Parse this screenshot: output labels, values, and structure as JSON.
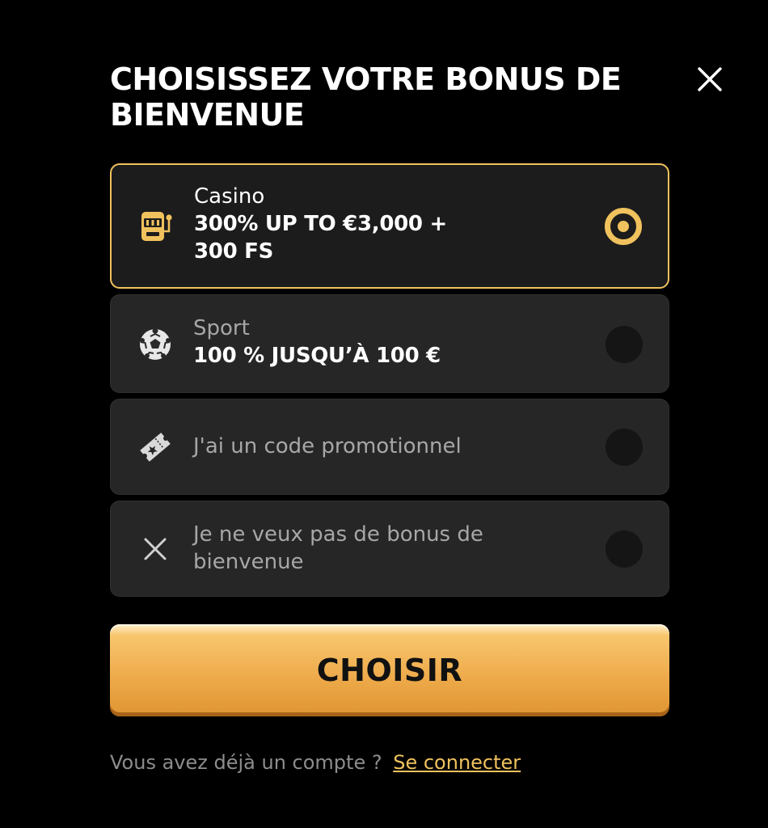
{
  "header": {
    "title": "CHOISISSEZ VOTRE BONUS DE BIENVENUE",
    "close_icon": "close-icon"
  },
  "options": [
    {
      "label": "Casino",
      "offer": "300% UP TO €3,000 + 300 FS",
      "icon": "slot-machine-icon",
      "selected": true
    },
    {
      "label": "Sport",
      "offer": "100 % JUSQU’À 100 €",
      "icon": "soccer-ball-icon",
      "selected": false
    },
    {
      "label": "J'ai un code promotionnel",
      "icon": "promo-ticket-icon",
      "selected": false
    },
    {
      "label": "Je ne veux pas de bonus de bienvenue",
      "icon": "no-bonus-x-icon",
      "selected": false
    }
  ],
  "submit": {
    "label": "CHOISIR"
  },
  "footer": {
    "text": "Vous avez déjà un compte ?",
    "link": "Se connecter"
  },
  "colors": {
    "background": "#000000",
    "card": "#262626",
    "accent": "#f0c25d",
    "button_gradient_top": "#f8c66e",
    "button_gradient_bottom": "#df9432"
  }
}
